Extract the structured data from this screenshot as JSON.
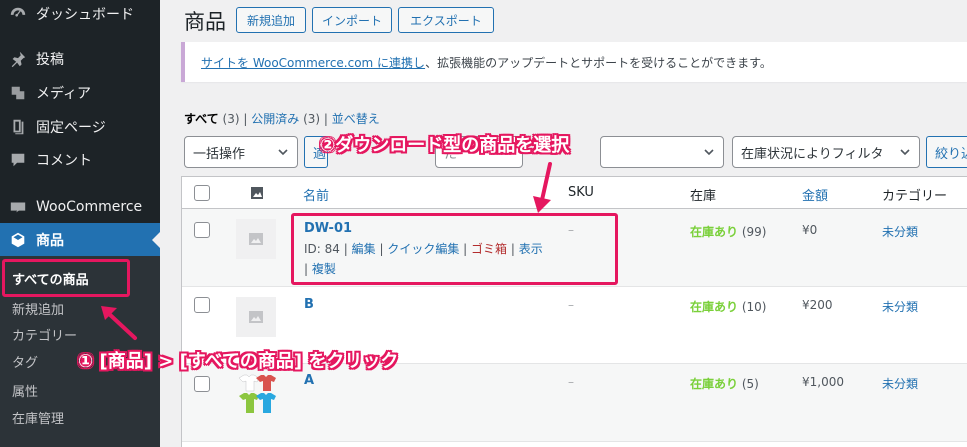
{
  "sidebar": {
    "items": [
      {
        "label": "ダッシュボード",
        "icon": "dashboard-icon"
      },
      {
        "label": "投稿",
        "icon": "pin-icon"
      },
      {
        "label": "メディア",
        "icon": "media-icon"
      },
      {
        "label": "固定ページ",
        "icon": "page-icon"
      },
      {
        "label": "コメント",
        "icon": "comment-icon"
      },
      {
        "label": "WooCommerce",
        "icon": "woo-icon"
      },
      {
        "label": "商品",
        "icon": "product-icon"
      }
    ],
    "submenu": [
      "すべての商品",
      "新規追加",
      "カテゴリー",
      "タグ",
      "属性",
      "在庫管理"
    ]
  },
  "header": {
    "title": "商品",
    "buttons": [
      "新規追加",
      "インポート",
      "エクスポート"
    ]
  },
  "notice": {
    "link": "サイトを WooCommerce.com に連携し",
    "text": "、拡張機能のアップデートとサポートを受けることができます。"
  },
  "filters": {
    "all": "すべて",
    "all_count": "(3)",
    "published": "公開済み",
    "published_count": "(3)",
    "sort": "並べ替え",
    "sep": "|"
  },
  "controls": {
    "bulk_action": "一括操作",
    "apply_partial": "適",
    "category_partial": "た",
    "stock_filter": "在庫状況によりフィルタ",
    "filter_partial": "絞り込"
  },
  "table": {
    "headers": {
      "name": "名前",
      "sku": "SKU",
      "stock": "在庫",
      "price": "金額",
      "category": "カテゴリー"
    },
    "rows": [
      {
        "name": "DW-01",
        "id_text": "ID: 84 |",
        "edit": "編集",
        "quick": "クイック編集",
        "trash": "ゴミ箱",
        "view": "表示",
        "copy": "複製",
        "sep": "|",
        "sku": "–",
        "stock": "在庫あり",
        "stock_count": "(99)",
        "price": "¥0",
        "category": "未分類"
      },
      {
        "name": "B",
        "sku": "–",
        "stock": "在庫あり",
        "stock_count": "(10)",
        "price": "¥200",
        "category": "未分類"
      },
      {
        "name": "A",
        "sku": "–",
        "stock": "在庫あり",
        "stock_count": "(5)",
        "price": "¥1,000",
        "category": "未分類"
      }
    ]
  },
  "annotations": {
    "step1": "① [商品] > [すべての商品] をクリック",
    "step2": "②ダウンロード型の商品を選択"
  },
  "colors": {
    "accent": "#2271b1",
    "highlight": "#e5175f",
    "stock": "#7ad03a",
    "trash": "#b32d2e"
  }
}
